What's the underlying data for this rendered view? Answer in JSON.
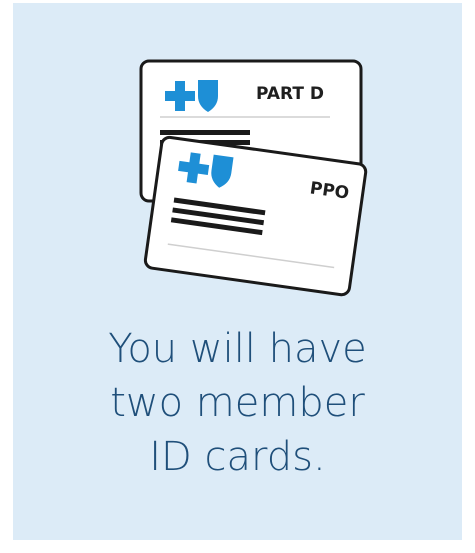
{
  "cards": [
    {
      "label": "PART D",
      "logo_icons": [
        "cross-icon",
        "shield-icon"
      ]
    },
    {
      "label": "PPO",
      "logo_icons": [
        "cross-icon",
        "shield-icon"
      ]
    }
  ],
  "caption": {
    "line1": "You will have",
    "line2": "two member",
    "line3": "ID cards."
  },
  "colors": {
    "background": "#dcebf7",
    "logo_blue": "#1e8fd6",
    "caption": "#1f4f7a"
  }
}
